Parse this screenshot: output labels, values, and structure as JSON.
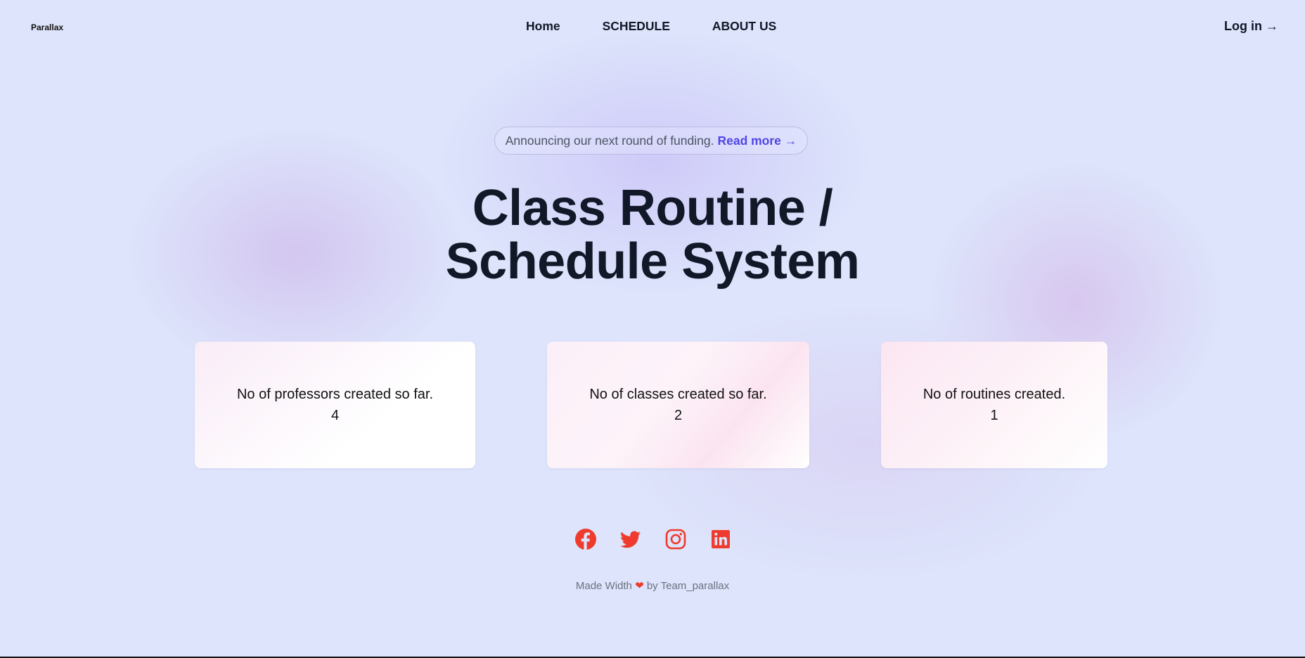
{
  "header": {
    "brand": "Parallax",
    "nav": [
      {
        "label": "Home"
      },
      {
        "label": "SCHEDULE"
      },
      {
        "label": "ABOUT US"
      }
    ],
    "login_label": "Log in →"
  },
  "announcement": {
    "text": "Announcing our next round of funding.",
    "link_label": "Read more →"
  },
  "hero": {
    "title_line1": "Class Routine /",
    "title_line2": "Schedule System"
  },
  "stats": [
    {
      "label": "No of professors created so far.",
      "value": "4"
    },
    {
      "label": "No of classes created so far.",
      "value": "2"
    },
    {
      "label": "No of routines created.",
      "value": "1"
    }
  ],
  "social": [
    {
      "icon": "facebook-icon"
    },
    {
      "icon": "twitter-icon"
    },
    {
      "icon": "instagram-icon"
    },
    {
      "icon": "linkedin-icon"
    }
  ],
  "footer": {
    "prefix": "Made Width",
    "heart": "❤",
    "suffix": "by Team_parallax"
  },
  "colors": {
    "background": "#dde4fb",
    "accent_link": "#4f46e5",
    "social_icon": "#ef3b2d",
    "heading": "#111827"
  }
}
